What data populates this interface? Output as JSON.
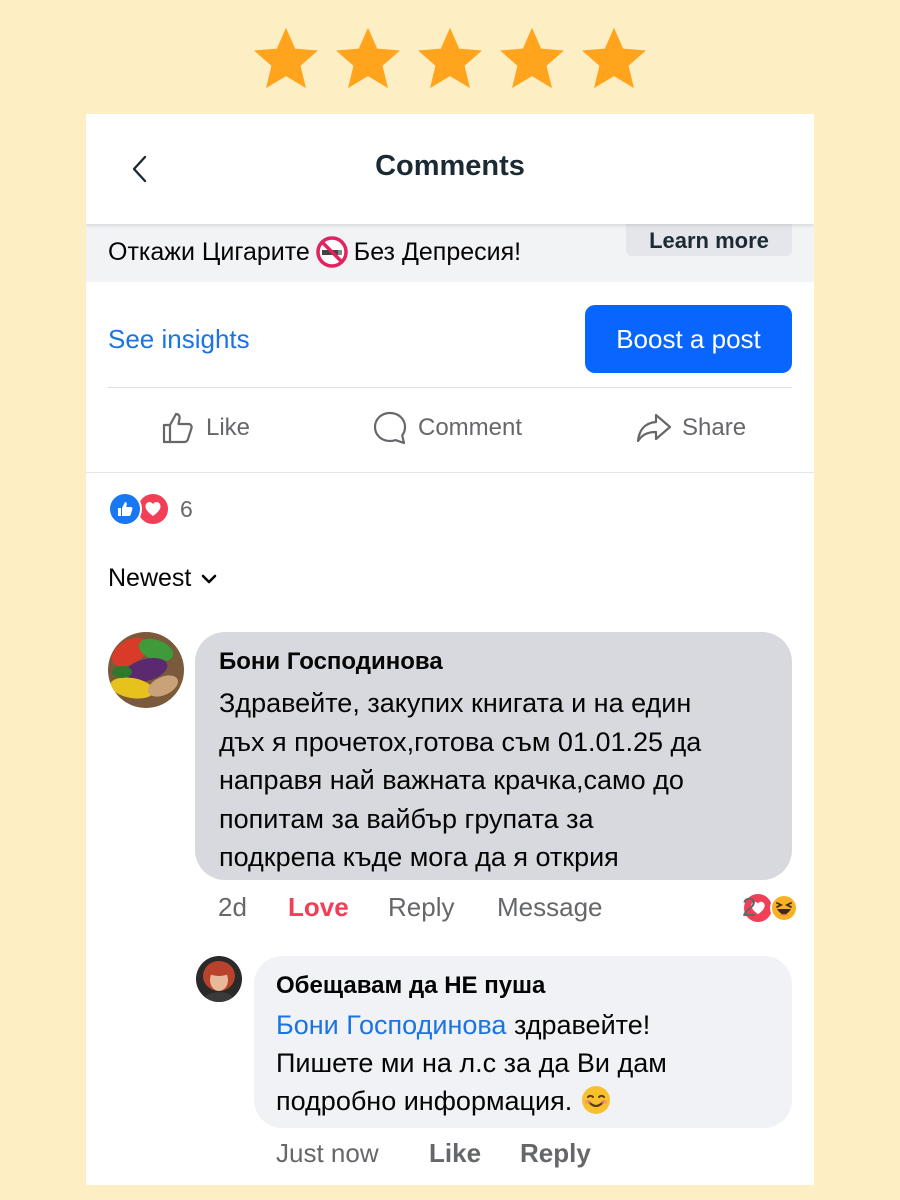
{
  "rating": {
    "stars": 5,
    "max": 5,
    "star_color": "#ffa41c"
  },
  "header": {
    "title": "Comments",
    "back_icon": "chevron-left-icon"
  },
  "promo": {
    "text_before": "Откажи Цигарите",
    "emoji": "no-smoking-icon",
    "text_after": "Без Депресия!",
    "learn_more": "Learn more"
  },
  "insights": {
    "link": "See insights",
    "boost_label": "Boost a post"
  },
  "actions": [
    {
      "label": "Like",
      "icon": "thumbs-up-icon"
    },
    {
      "label": "Comment",
      "icon": "comment-icon"
    },
    {
      "label": "Share",
      "icon": "share-icon"
    }
  ],
  "reactions": {
    "count": "6",
    "types": [
      "like",
      "love"
    ]
  },
  "sort": {
    "label": "Newest"
  },
  "comments": [
    {
      "author": "Бони Господинова",
      "lines": [
        "Здравейте, закупих книгата и на един",
        "дъх я прочетох,готова съм 01.01.25 да",
        "направя най важната крачка,само до",
        "попитам за вайбър групата за",
        "подкрепа къде мога да я открия"
      ],
      "time": "2d",
      "reaction_label": "Love",
      "reply": "Reply",
      "message": "Message",
      "reaction_count": "2",
      "reaction_types": [
        "love",
        "haha"
      ]
    },
    {
      "author": "Обещавам да НЕ пуша",
      "mention": "Бони Господинова",
      "line1_rest": " здравейте!",
      "line2": "Пишете ми на л.с за да Ви дам",
      "line3": "подробно информация.",
      "emoji": "smiling-face-icon",
      "time": "Just now",
      "like": "Like",
      "reply": "Reply"
    }
  ],
  "colors": {
    "background": "#fdefc3",
    "accent_blue": "#0866ff",
    "link_blue": "#1b74e4",
    "love_red": "#f33e58"
  }
}
